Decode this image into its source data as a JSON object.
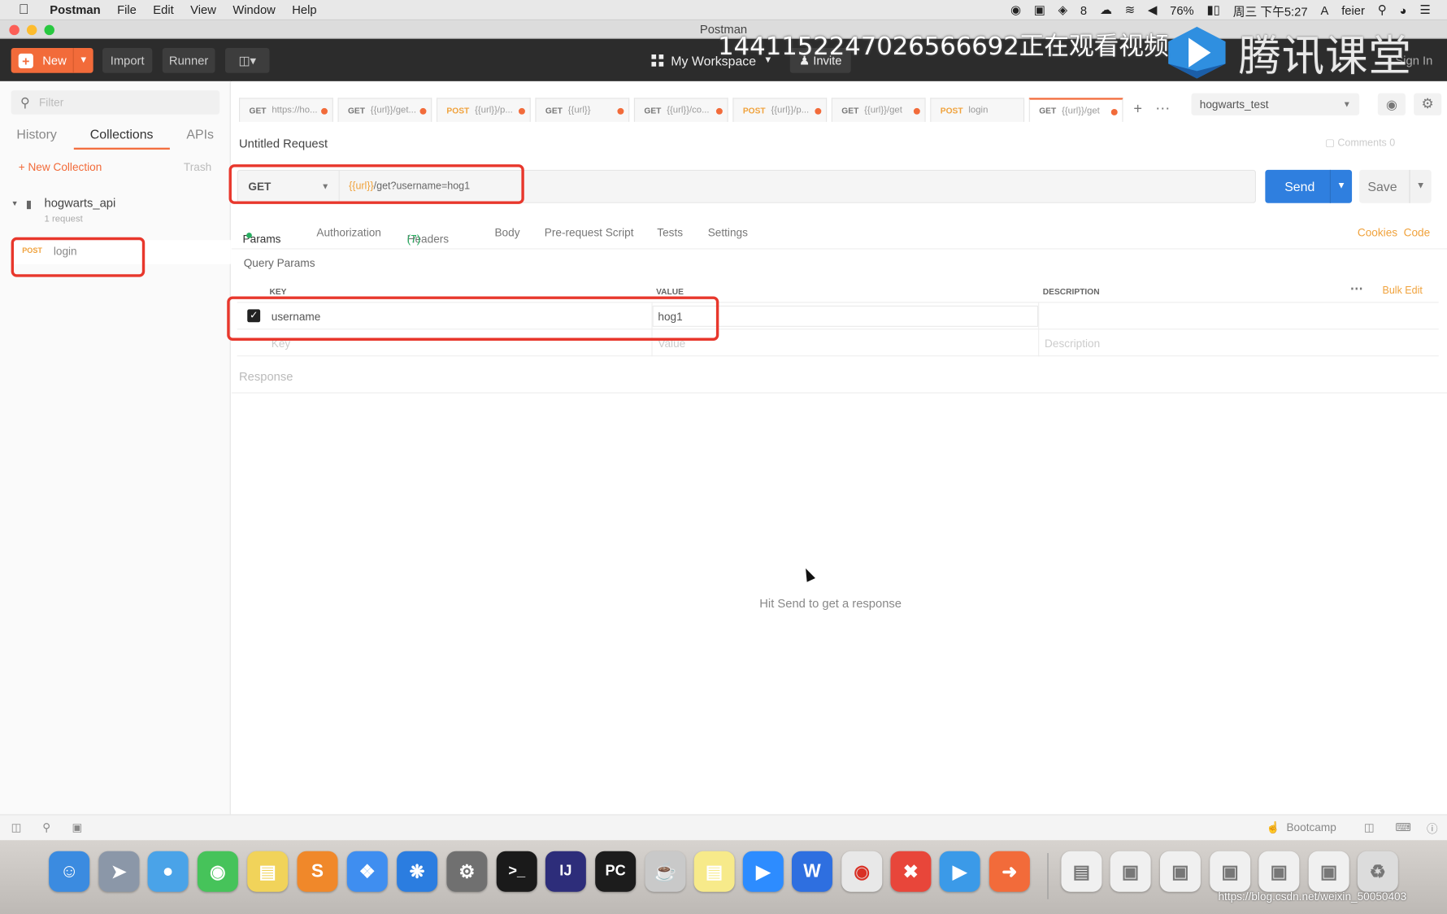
{
  "menubar": {
    "items": [
      "Postman",
      "File",
      "Edit",
      "View",
      "Window",
      "Help"
    ],
    "badge_count": "8",
    "battery": "76%",
    "clock": "周三 下午5:27",
    "user": "feier"
  },
  "window": {
    "title": "Postman"
  },
  "header": {
    "new_label": "New",
    "import_label": "Import",
    "runner_label": "Runner",
    "workspace_label": "My Workspace",
    "invite_label": "Invite",
    "signin_label": "Sign In",
    "brand_text": "腾讯课堂"
  },
  "overlay": {
    "watermark": "1441152247026566692正在观看视频"
  },
  "sidebar": {
    "filter_placeholder": "Filter",
    "tabs": [
      "History",
      "Collections",
      "APIs"
    ],
    "new_collection": "New Collection",
    "trash": "Trash",
    "collection": {
      "name": "hogwarts_api",
      "count": "1 request"
    },
    "request": {
      "method": "POST",
      "name": "login"
    }
  },
  "tabs": [
    {
      "method": "GET",
      "label": "https://ho..."
    },
    {
      "method": "GET",
      "label": "{{url}}/get..."
    },
    {
      "method": "POST",
      "label": "{{url}}/p..."
    },
    {
      "method": "GET",
      "label": "{{url}}"
    },
    {
      "method": "GET",
      "label": "{{url}}/co..."
    },
    {
      "method": "POST",
      "label": "{{url}}/p..."
    },
    {
      "method": "GET",
      "label": "{{url}}/get"
    },
    {
      "method": "POST",
      "label": "login"
    },
    {
      "method": "GET",
      "label": "{{url}}/get"
    }
  ],
  "environment": {
    "selected": "hogwarts_test"
  },
  "request": {
    "title": "Untitled Request",
    "comments": "Comments 0",
    "method": "GET",
    "url_var": "{{url}}",
    "url_rest": "/get?username=hog1",
    "send_label": "Send",
    "save_label": "Save"
  },
  "request_tabs": {
    "params": "Params",
    "authorization": "Authorization",
    "headers": "Headers",
    "headers_count": "(7)",
    "body": "Body",
    "prerequest": "Pre-request Script",
    "tests": "Tests",
    "settings": "Settings",
    "cookies": "Cookies",
    "code": "Code"
  },
  "params": {
    "section_title": "Query Params",
    "headers": {
      "key": "KEY",
      "value": "VALUE",
      "description": "DESCRIPTION",
      "bulk_edit": "Bulk Edit"
    },
    "rows": [
      {
        "key": "username",
        "value": "hog1",
        "checked": true
      }
    ],
    "placeholder": {
      "key": "Key",
      "value": "Value",
      "description": "Description"
    }
  },
  "response": {
    "title": "Response",
    "hint": "Hit Send to get a response"
  },
  "footer": {
    "bootcamp": "Bootcamp"
  },
  "dock_credit": "https://blog.csdn.net/weixin_50050403",
  "colors": {
    "accent": "#f26b3a",
    "send": "#2f7fdf",
    "annotation": "#e8372c"
  }
}
